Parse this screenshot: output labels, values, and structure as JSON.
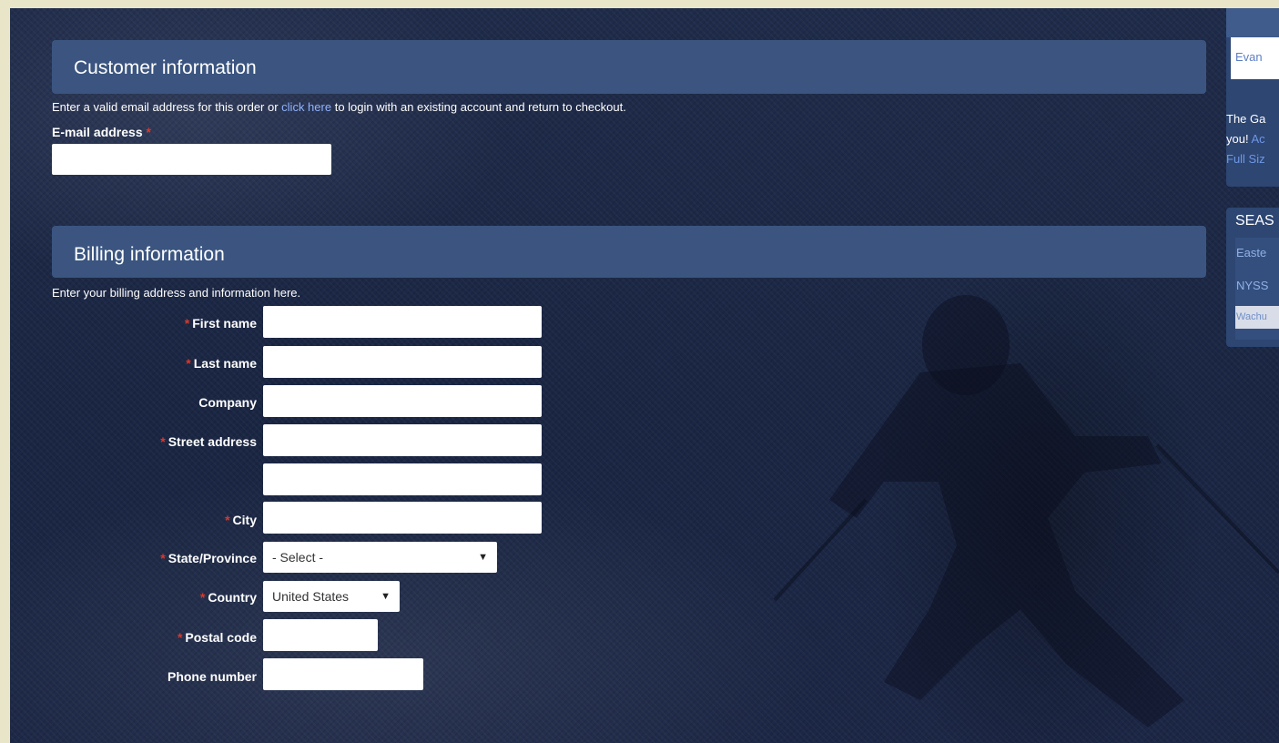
{
  "customer": {
    "heading": "Customer information",
    "desc_before": "Enter a valid email address for this order or ",
    "desc_link": "click here",
    "desc_after": " to login with an existing account and return to checkout.",
    "email_label": "E-mail address",
    "email_value": ""
  },
  "billing": {
    "heading": "Billing information",
    "desc": "Enter your billing address and information here.",
    "first_name_label": "First name",
    "last_name_label": "Last name",
    "company_label": "Company",
    "street_label": "Street address",
    "city_label": "City",
    "state_label": "State/Province",
    "state_value": "- Select -",
    "country_label": "Country",
    "country_value": "United States",
    "postal_label": "Postal code",
    "phone_label": "Phone number",
    "required_mark": "*",
    "caret": "▼"
  },
  "sidebar": {
    "top_link": "Evan",
    "gallery_text_1": "The Ga",
    "gallery_text_2_plain": "you! ",
    "gallery_text_2_link": "Ac",
    "gallery_link_3": "Full Siz",
    "season_heading": "SEAS",
    "season_items": [
      "Easte",
      "NYSS",
      "Wachu"
    ]
  },
  "colors": {
    "header_bg": "#3b5580",
    "required": "#d9392c",
    "link": "#8fb3ff"
  }
}
